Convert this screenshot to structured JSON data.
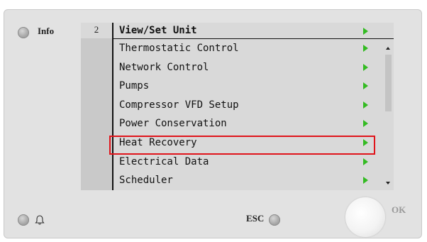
{
  "panel": {
    "info_label": "Info",
    "esc_label": "ESC",
    "ok_label": "OK"
  },
  "screen": {
    "page_number": "2",
    "title": "View/Set Unit",
    "menu_items": [
      {
        "label": "Thermostatic Control"
      },
      {
        "label": "Network Control"
      },
      {
        "label": "Pumps"
      },
      {
        "label": "Compressor VFD Setup"
      },
      {
        "label": "Power Conservation"
      },
      {
        "label": "Heat Recovery",
        "highlighted": true
      },
      {
        "label": "Electrical Data"
      },
      {
        "label": "Scheduler"
      }
    ]
  },
  "colors": {
    "arrow": "#33bb22",
    "highlight": "#e0141b"
  },
  "icons": {
    "arrow": "arrow-right-icon",
    "bell": "bell-icon"
  }
}
